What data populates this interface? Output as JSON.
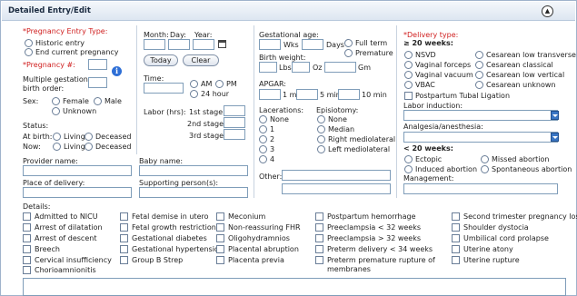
{
  "header": {
    "title": "Detailed Entry/Edit"
  },
  "pregnancy": {
    "entry_type_label": "*Pregnancy Entry Type:",
    "opt_historic": "Historic entry",
    "opt_end": "End current pregnancy",
    "num_label": "*Pregnancy #:",
    "multi_label_1": "Multiple gestation",
    "multi_label_2": "birth order:",
    "info_icon": "i"
  },
  "sex": {
    "label": "Sex:",
    "female": "Female",
    "male": "Male",
    "unknown": "Unknown"
  },
  "status": {
    "label": "Status:",
    "at_birth": "At birth:",
    "now": "Now:",
    "living": "Living",
    "deceased": "Deceased"
  },
  "date": {
    "month": "Month:",
    "day": "Day:",
    "year": "Year:",
    "today": "Today",
    "clear": "Clear"
  },
  "time": {
    "label": "Time:",
    "am": "AM",
    "pm": "PM",
    "h24": "24 hour"
  },
  "labor": {
    "label": "Labor (hrs):",
    "stage1": "1st stage:",
    "stage2": "2nd stage:",
    "stage3": "3rd stage:"
  },
  "gest": {
    "label": "Gestational age:",
    "wks": "Wks",
    "days": "Days",
    "full_term": "Full term",
    "premature": "Premature"
  },
  "weight": {
    "label": "Birth weight:",
    "lbs": "Lbs",
    "oz": "Oz",
    "gm": "Gm"
  },
  "apgar": {
    "label": "APGAR:",
    "min1": "1 min",
    "min5": "5 min",
    "min10": "10 min"
  },
  "lacerations": {
    "label": "Lacerations:",
    "options": [
      "None",
      "1",
      "2",
      "3",
      "4"
    ]
  },
  "episiotomy": {
    "label": "Episiotomy:",
    "options": [
      "None",
      "Median",
      "Right mediolateral",
      "Left mediolateral"
    ]
  },
  "other": {
    "label": "Other:"
  },
  "delivery": {
    "label": "*Delivery type:",
    "ge20": "≥ 20 weeks:",
    "nsvd": "NSVD",
    "cs_lt": "Cesarean low transverse",
    "vag_forceps": "Vaginal forceps",
    "cs_classical": "Cesarean classical",
    "vag_vacuum": "Vaginal vacuum",
    "cs_lv": "Cesarean low vertical",
    "vbac": "VBAC",
    "cs_unknown": "Cesarean unknown",
    "tubal": "Postpartum Tubal Ligation",
    "induction": "Labor induction:",
    "analgesia": "Analgesia/anesthesia:",
    "lt20": "< 20 weeks:",
    "ectopic": "Ectopic",
    "missed": "Missed abortion",
    "induced": "Induced abortion",
    "spontaneous": "Spontaneous abortion",
    "management": "Management:"
  },
  "people": {
    "provider": "Provider name:",
    "baby": "Baby name:",
    "place": "Place of delivery:",
    "support": "Supporting person(s):"
  },
  "details": {
    "label": "Details:",
    "col1": [
      "Admitted to NICU",
      "Arrest of dilatation",
      "Arrest of descent",
      "Breech",
      "Cervical insufficiency",
      "Chorioamnionitis"
    ],
    "col2": [
      "Fetal demise in utero",
      "Fetal growth restriction",
      "Gestational diabetes",
      "Gestational hypertension",
      "Group B Strep"
    ],
    "col3": [
      "Meconium",
      "Non-reassuring FHR",
      "Oligohydramnios",
      "Placental abruption",
      "Placenta previa"
    ],
    "col4": [
      "Postpartum hemorrhage",
      "Preeclampsia < 32 weeks",
      "Preeclampsia > 32 weeks",
      "Preterm delivery < 34 weeks",
      "Preterm premature rupture of",
      "membranes"
    ],
    "col5": [
      "Second trimester pregnancy loss",
      "Shoulder dystocia",
      "Umbilical cord prolapse",
      "Uterine atony",
      "Uterine rupture"
    ]
  }
}
